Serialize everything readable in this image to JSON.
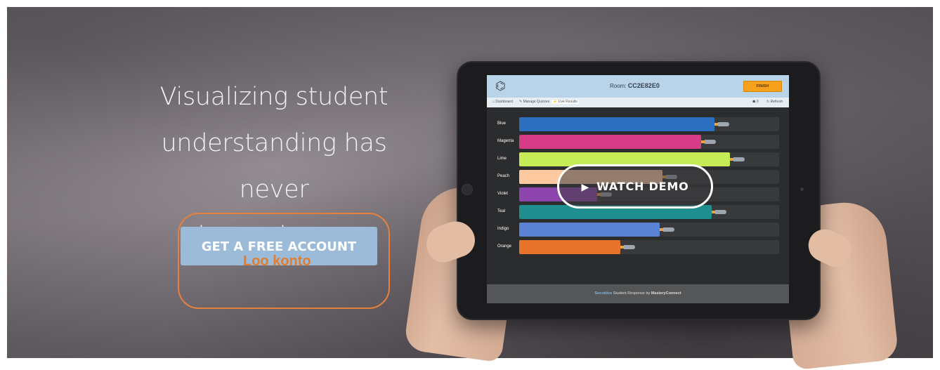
{
  "hero": {
    "headline_line1": "Visualizing student",
    "headline_line2": "understanding has never",
    "headline_line3": "been clearer",
    "cta_label": "GET A FREE ACCOUNT",
    "annotation_text": "Loo konto",
    "watch_demo_label": "WATCH DEMO",
    "colors": {
      "cta_bg": "#9bbbd9",
      "annotation": "#e37d2b"
    }
  },
  "tablet_app": {
    "logo_icon": "hexagon-cluster-icon",
    "room_label": "Room:",
    "room_code": "CC2E82E0",
    "finish_label": "FINISH",
    "nav": {
      "dashboard": "Dashboard",
      "manage_quizzes": "Manage Quizzes",
      "live_results": "Live Results",
      "count": "0",
      "refresh": "Refresh"
    },
    "teams": [
      {
        "label": "Blue",
        "progress": 0.75,
        "color": "#2d6fbf"
      },
      {
        "label": "Magenta",
        "progress": 0.7,
        "color": "#d63b86"
      },
      {
        "label": "Lime",
        "progress": 0.81,
        "color": "#c5ec57"
      },
      {
        "label": "Peach",
        "progress": 0.55,
        "color": "#fcc9a0"
      },
      {
        "label": "Violet",
        "progress": 0.3,
        "color": "#8e44ad"
      },
      {
        "label": "Teal",
        "progress": 0.74,
        "color": "#1f8e8e"
      },
      {
        "label": "Indigo",
        "progress": 0.54,
        "color": "#5a83d6"
      },
      {
        "label": "Orange",
        "progress": 0.39,
        "color": "#e8732b"
      }
    ],
    "footer_brand": "Socrative",
    "footer_mid": " Student Response by ",
    "footer_company": "MasteryConnect"
  }
}
